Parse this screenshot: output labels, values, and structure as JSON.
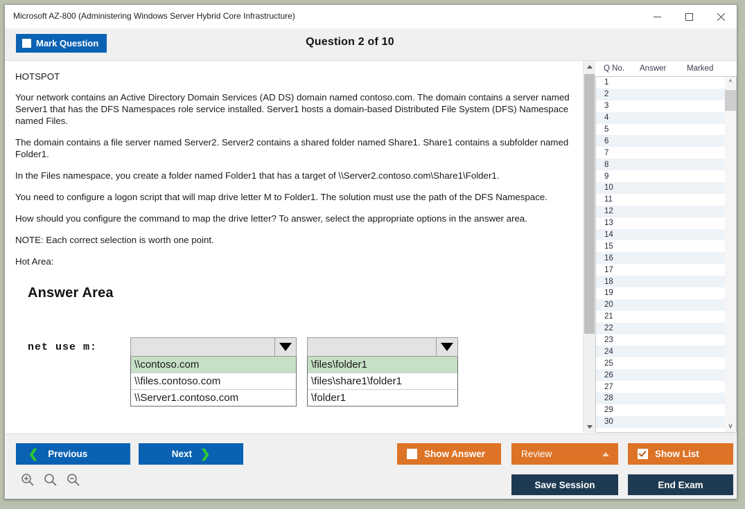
{
  "window": {
    "title": "Microsoft AZ-800 (Administering Windows Server Hybrid Core Infrastructure)",
    "minimize_icon": "minimize-icon",
    "maximize_icon": "maximize-icon",
    "close_icon": "close-icon"
  },
  "header": {
    "mark_question_label": "Mark Question",
    "question_counter": "Question 2 of 10"
  },
  "question": {
    "type_label": "HOTSPOT",
    "paragraphs": [
      "Your network contains an Active Directory Domain Services (AD DS) domain named contoso.com. The domain contains a server named Server1 that has the DFS Namespaces role service installed. Server1 hosts a domain-based Distributed File System (DFS) Namespace named Files.",
      "The domain contains a file server named Server2. Server2 contains a shared folder named Share1. Share1 contains a subfolder named Folder1.",
      "In the Files namespace, you create a folder named Folder1 that has a target of \\\\Server2.contoso.com\\Share1\\Folder1.",
      "You need to configure a logon script that will map drive letter M to Folder1. The solution must use the path of the DFS Namespace.",
      "How should you configure the command to map the drive letter? To answer, select the appropriate options in the answer area.",
      "NOTE: Each correct selection is worth one point.",
      "Hot Area:"
    ]
  },
  "answer_area": {
    "title": "Answer Area",
    "command_prefix": "net use m:",
    "dropdown1": {
      "selected_value": "",
      "arrow_icon": "triangle-down-icon",
      "options": [
        "\\\\contoso.com",
        "\\\\files.contoso.com",
        "\\\\Server1.contoso.com"
      ],
      "highlighted_index": 0
    },
    "dropdown2": {
      "selected_value": "",
      "arrow_icon": "triangle-down-icon",
      "options": [
        "\\files\\folder1",
        "\\files\\share1\\folder1",
        "\\folder1"
      ],
      "highlighted_index": 0
    }
  },
  "question_list": {
    "columns": [
      "Q No.",
      "Answer",
      "Marked"
    ],
    "rows": [
      {
        "no": "1",
        "answer": "",
        "marked": ""
      },
      {
        "no": "2",
        "answer": "",
        "marked": ""
      },
      {
        "no": "3",
        "answer": "",
        "marked": ""
      },
      {
        "no": "4",
        "answer": "",
        "marked": ""
      },
      {
        "no": "5",
        "answer": "",
        "marked": ""
      },
      {
        "no": "6",
        "answer": "",
        "marked": ""
      },
      {
        "no": "7",
        "answer": "",
        "marked": ""
      },
      {
        "no": "8",
        "answer": "",
        "marked": ""
      },
      {
        "no": "9",
        "answer": "",
        "marked": ""
      },
      {
        "no": "10",
        "answer": "",
        "marked": ""
      },
      {
        "no": "11",
        "answer": "",
        "marked": ""
      },
      {
        "no": "12",
        "answer": "",
        "marked": ""
      },
      {
        "no": "13",
        "answer": "",
        "marked": ""
      },
      {
        "no": "14",
        "answer": "",
        "marked": ""
      },
      {
        "no": "15",
        "answer": "",
        "marked": ""
      },
      {
        "no": "16",
        "answer": "",
        "marked": ""
      },
      {
        "no": "17",
        "answer": "",
        "marked": ""
      },
      {
        "no": "18",
        "answer": "",
        "marked": ""
      },
      {
        "no": "19",
        "answer": "",
        "marked": ""
      },
      {
        "no": "20",
        "answer": "",
        "marked": ""
      },
      {
        "no": "21",
        "answer": "",
        "marked": ""
      },
      {
        "no": "22",
        "answer": "",
        "marked": ""
      },
      {
        "no": "23",
        "answer": "",
        "marked": ""
      },
      {
        "no": "24",
        "answer": "",
        "marked": ""
      },
      {
        "no": "25",
        "answer": "",
        "marked": ""
      },
      {
        "no": "26",
        "answer": "",
        "marked": ""
      },
      {
        "no": "27",
        "answer": "",
        "marked": ""
      },
      {
        "no": "28",
        "answer": "",
        "marked": ""
      },
      {
        "no": "29",
        "answer": "",
        "marked": ""
      },
      {
        "no": "30",
        "answer": "",
        "marked": ""
      }
    ]
  },
  "footer": {
    "previous_label": "Previous",
    "next_label": "Next",
    "show_answer_label": "Show Answer",
    "review_label": "Review",
    "show_list_label": "Show List",
    "save_session_label": "Save Session",
    "end_exam_label": "End Exam",
    "zoom_in_icon": "zoom-in-icon",
    "zoom_reset_icon": "zoom-icon",
    "zoom_out_icon": "zoom-out-icon",
    "prev_chevron_icon": "chevron-left-icon",
    "next_chevron_icon": "chevron-right-icon",
    "review_caret_icon": "caret-up-icon"
  },
  "colors": {
    "primary_blue": "#0b62b3",
    "orange": "#dd7326",
    "navy": "#1e3a52",
    "green_accent": "#2ecc2e",
    "highlight_green": "#c6e0c6",
    "row_alt": "#eef3f8"
  }
}
